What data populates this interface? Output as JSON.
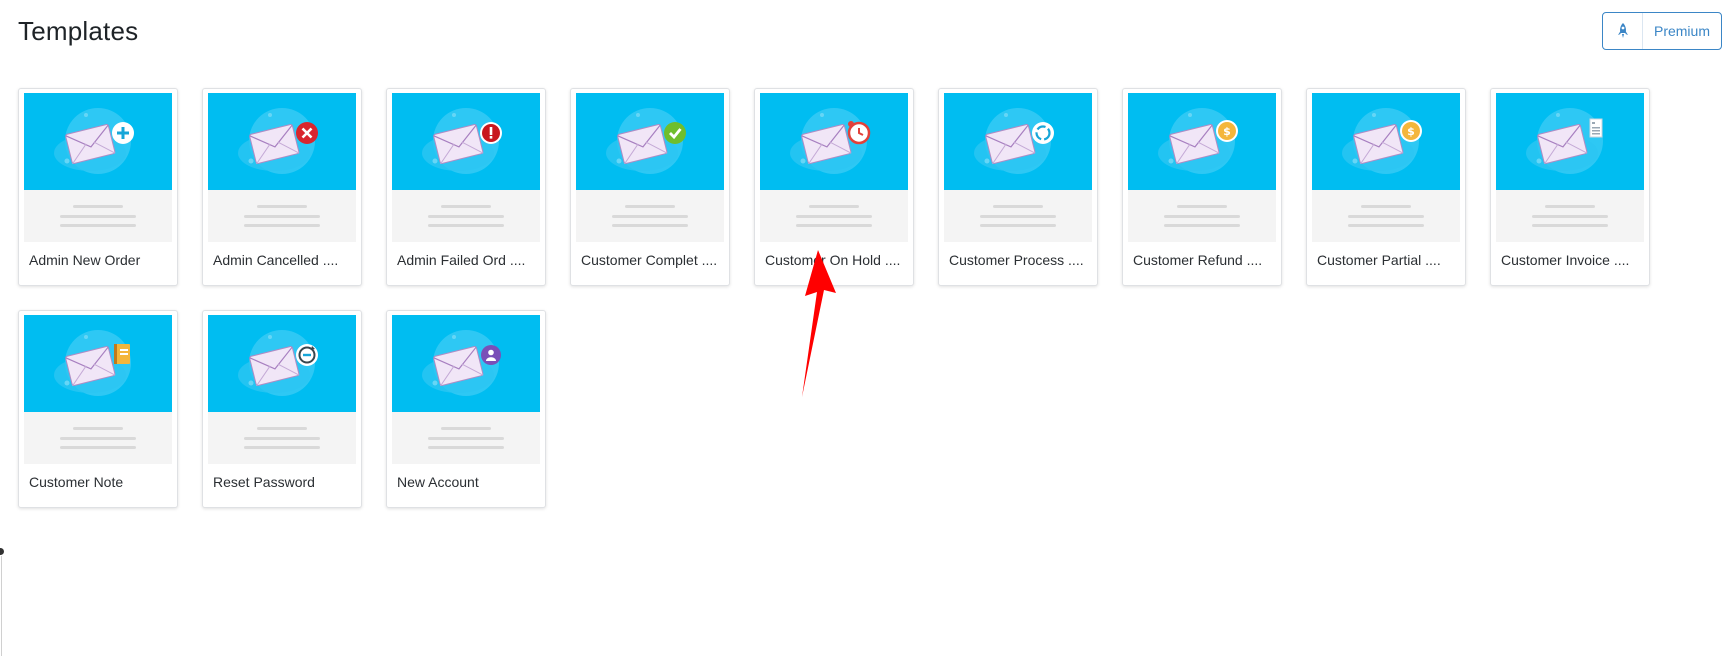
{
  "header": {
    "title": "Templates",
    "premium_label": "Premium",
    "premium_icon": "rocket-icon"
  },
  "colors": {
    "thumb_bg": "#00bdf1",
    "accent": "#3b86c6",
    "arrow": "#ff0000"
  },
  "templates": [
    {
      "label": "Admin New Order",
      "badge": "plus"
    },
    {
      "label": "Admin Cancelled ....",
      "badge": "cancel"
    },
    {
      "label": "Admin Failed Ord ....",
      "badge": "alert"
    },
    {
      "label": "Customer Complet ....",
      "badge": "check"
    },
    {
      "label": "Customer On Hold ....",
      "badge": "clock"
    },
    {
      "label": "Customer Process ....",
      "badge": "refresh"
    },
    {
      "label": "Customer Refund ....",
      "badge": "coin"
    },
    {
      "label": "Customer Partial ....",
      "badge": "coin"
    },
    {
      "label": "Customer Invoice ....",
      "badge": "invoice"
    },
    {
      "label": "Customer Note",
      "badge": "note"
    },
    {
      "label": "Reset Password",
      "badge": "reset"
    },
    {
      "label": "New Account",
      "badge": "user"
    }
  ]
}
